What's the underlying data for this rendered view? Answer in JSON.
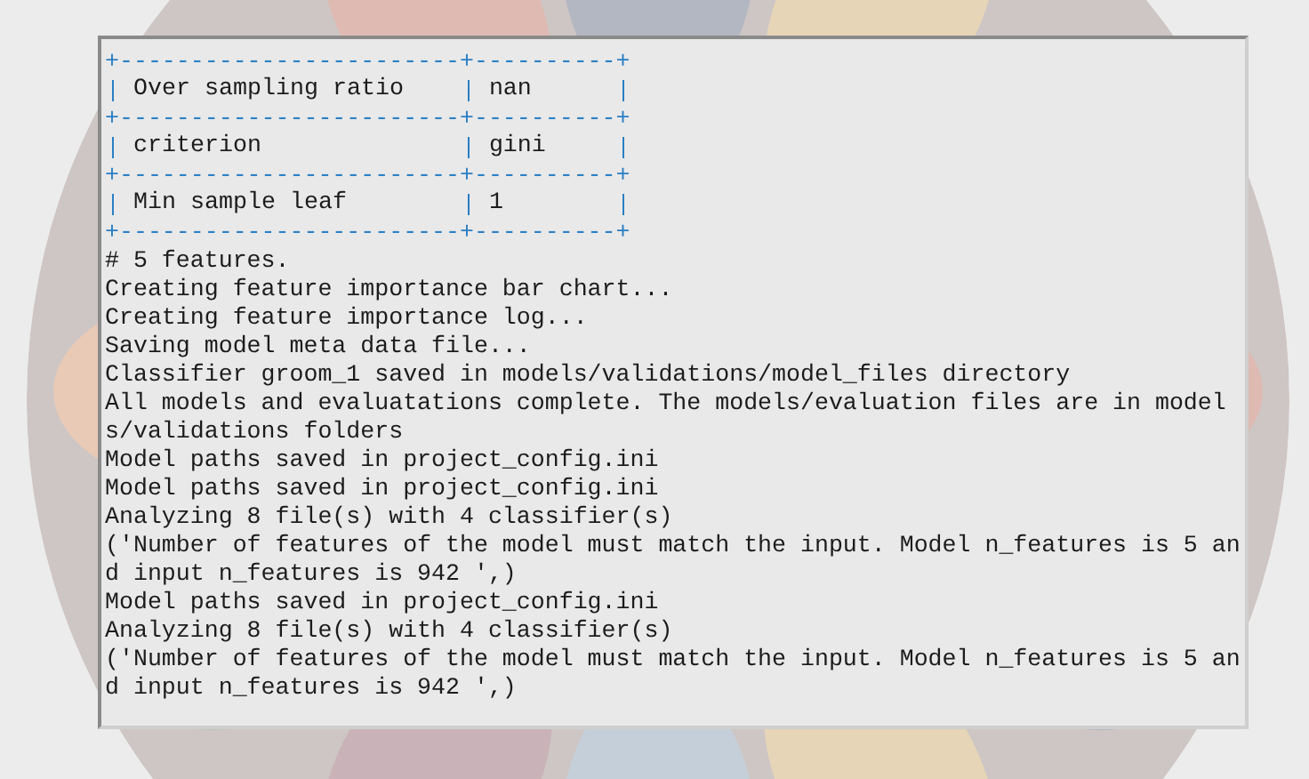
{
  "console": {
    "lines": [
      {
        "kind": "border",
        "text": "+------------------------+----------+"
      },
      {
        "kind": "row",
        "cells": [
          "Over sampling ratio",
          "nan"
        ]
      },
      {
        "kind": "border",
        "text": "+------------------------+----------+"
      },
      {
        "kind": "row",
        "cells": [
          "criterion",
          "gini"
        ]
      },
      {
        "kind": "border",
        "text": "+------------------------+----------+"
      },
      {
        "kind": "row",
        "cells": [
          "Min sample leaf",
          "1"
        ]
      },
      {
        "kind": "border",
        "text": "+------------------------+----------+"
      },
      {
        "kind": "text",
        "text": "# 5 features."
      },
      {
        "kind": "text",
        "text": "Creating feature importance bar chart..."
      },
      {
        "kind": "text",
        "text": "Creating feature importance log..."
      },
      {
        "kind": "text",
        "text": "Saving model meta data file..."
      },
      {
        "kind": "text",
        "text": "Classifier groom_1 saved in models/validations/model_files directory"
      },
      {
        "kind": "text",
        "text": "All models and evaluatations complete. The models/evaluation files are in models/validations folders"
      },
      {
        "kind": "text",
        "text": "Model paths saved in project_config.ini"
      },
      {
        "kind": "text",
        "text": "Model paths saved in project_config.ini"
      },
      {
        "kind": "text",
        "text": "Analyzing 8 file(s) with 4 classifier(s)"
      },
      {
        "kind": "text",
        "text": "('Number of features of the model must match the input. Model n_features is 5 and input n_features is 942 ',)"
      },
      {
        "kind": "text",
        "text": "Model paths saved in project_config.ini"
      },
      {
        "kind": "text",
        "text": "Analyzing 8 file(s) with 4 classifier(s)"
      },
      {
        "kind": "text",
        "text": "('Number of features of the model must match the input. Model n_features is 5 and input n_features is 942 ',)"
      }
    ]
  }
}
